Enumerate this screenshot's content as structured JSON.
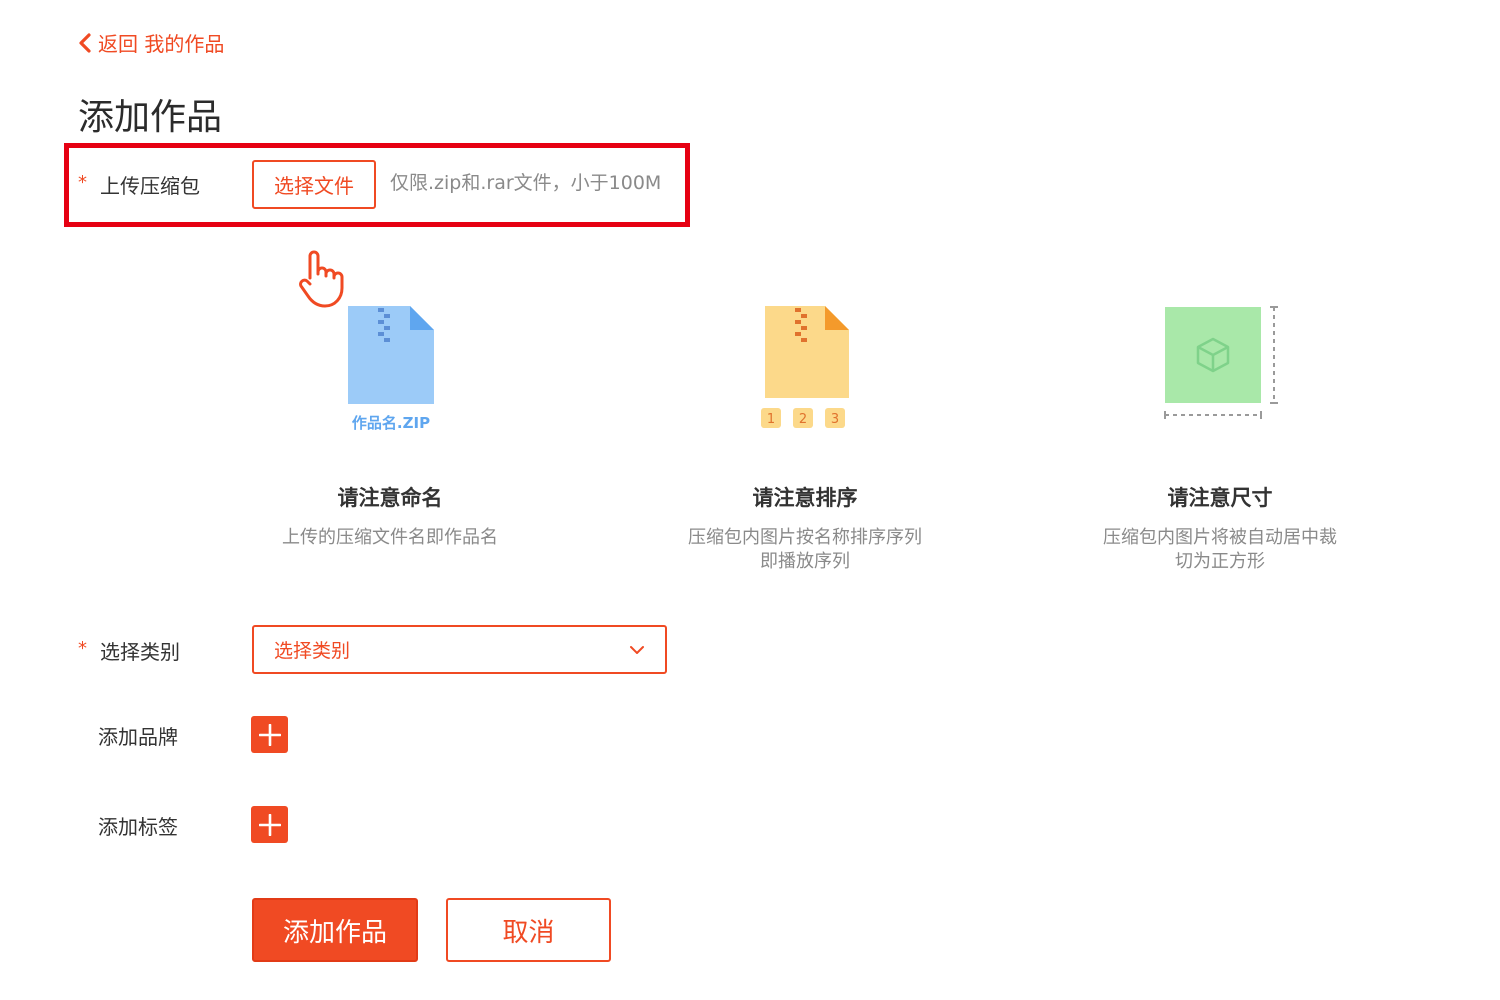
{
  "header": {
    "back_label": "返回 我的作品",
    "page_title": "添加作品"
  },
  "upload": {
    "required_mark": "*",
    "label": "上传压缩包",
    "button_label": "选择文件",
    "hint": "仅限.zip和.rar文件，小于100M"
  },
  "tips": [
    {
      "title": "请注意命名",
      "desc_line1": "上传的压缩文件名即作品名",
      "desc_line2": "",
      "icon": "zip-file-icon",
      "caption": "作品名.ZIP"
    },
    {
      "title": "请注意排序",
      "desc_line1": "压缩包内图片按名称排序序列",
      "desc_line2": "即播放序列",
      "icon": "ordered-zip-icon",
      "order_labels": [
        "1",
        "2",
        "3"
      ]
    },
    {
      "title": "请注意尺寸",
      "desc_line1": "压缩包内图片将被自动居中裁",
      "desc_line2": "切为正方形",
      "icon": "square-crop-icon"
    }
  ],
  "category": {
    "required_mark": "*",
    "label": "选择类别",
    "select_value": "选择类别"
  },
  "brand": {
    "label": "添加品牌"
  },
  "tag": {
    "label": "添加标签"
  },
  "actions": {
    "submit_label": "添加作品",
    "cancel_label": "取消"
  },
  "colors": {
    "accent": "#f04a23",
    "highlight_box": "#e60012",
    "zip_blue": "#9ccbf8",
    "zip_yellow": "#fcd98a",
    "crop_green": "#a9e8a9"
  }
}
